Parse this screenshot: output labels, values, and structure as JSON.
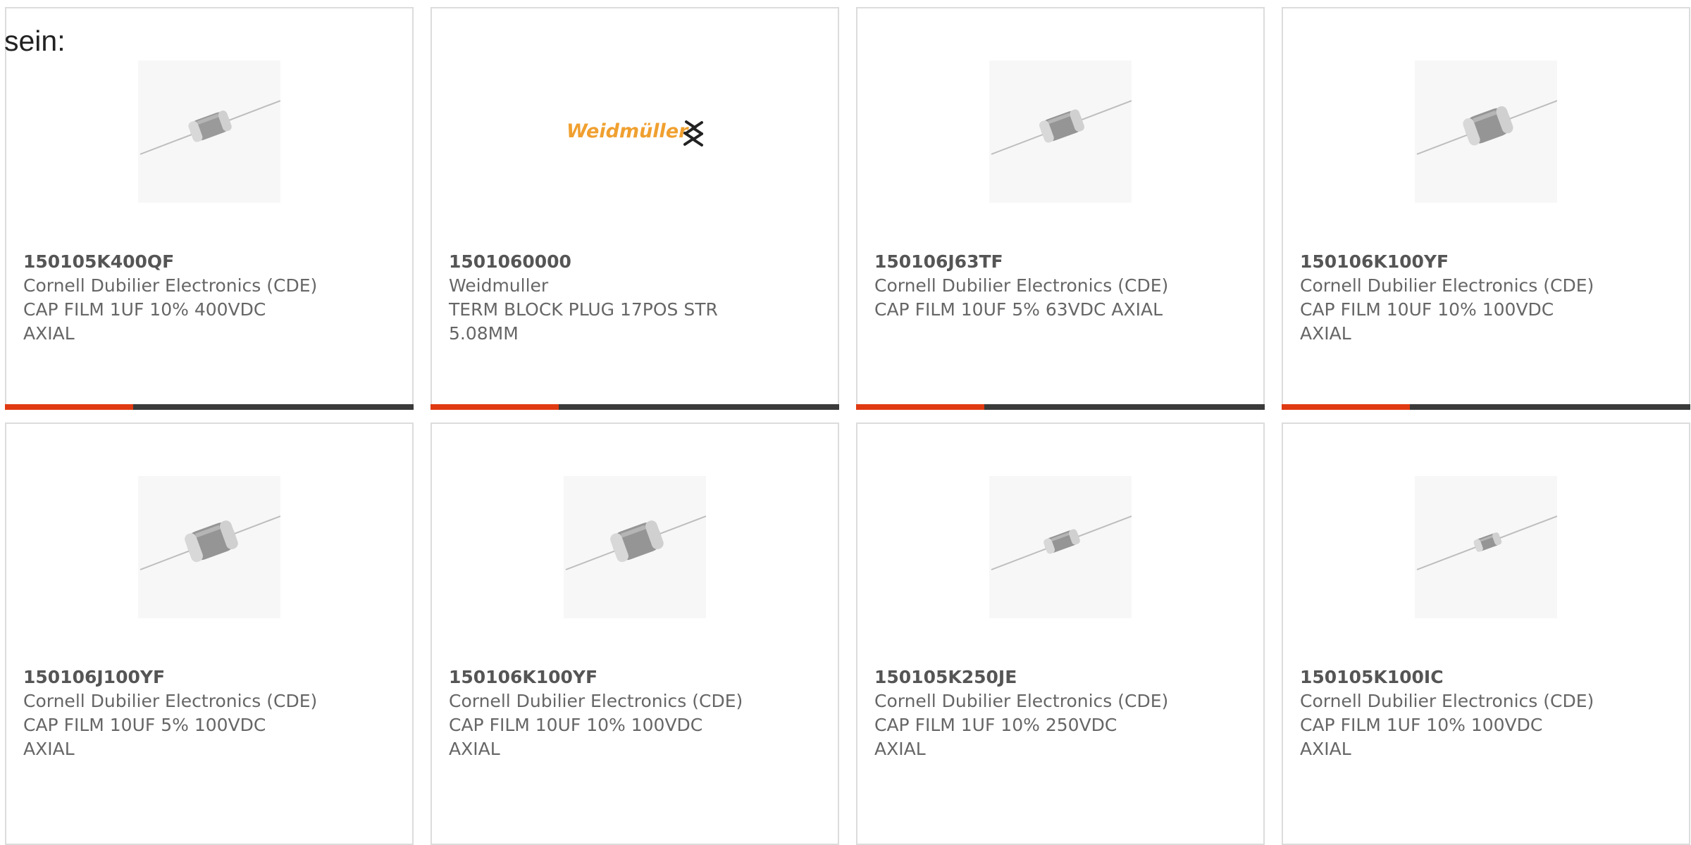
{
  "intro_text": "sein:",
  "colors": {
    "accent": "#e03a12",
    "bar": "#3a3a3a",
    "brand_orange": "#f0a030"
  },
  "products": [
    {
      "part_number": "150105K400QF",
      "manufacturer": "Cornell Dubilier Electronics (CDE)",
      "description_line1": "CAP FILM 1UF 10% 400VDC",
      "description_line2": "AXIAL",
      "image": "axial-capacitor-icon"
    },
    {
      "part_number": "1501060000",
      "manufacturer": "Weidmuller",
      "description_line1": "TERM BLOCK PLUG 17POS STR",
      "description_line2": "5.08MM",
      "image": "weidmuller-logo",
      "logo_text": "Weidmüller"
    },
    {
      "part_number": "150106J63TF",
      "manufacturer": "Cornell Dubilier Electronics (CDE)",
      "description_line1": "CAP FILM 10UF 5% 63VDC AXIAL",
      "description_line2": "",
      "image": "axial-capacitor-icon"
    },
    {
      "part_number": "150106K100YF",
      "manufacturer": "Cornell Dubilier Electronics (CDE)",
      "description_line1": "CAP FILM 10UF 10% 100VDC",
      "description_line2": "AXIAL",
      "image": "axial-capacitor-icon"
    },
    {
      "part_number": "150106J100YF",
      "manufacturer": "Cornell Dubilier Electronics (CDE)",
      "description_line1": "CAP FILM 10UF 5% 100VDC",
      "description_line2": "AXIAL",
      "image": "axial-capacitor-icon"
    },
    {
      "part_number": "150106K100YF",
      "manufacturer": "Cornell Dubilier Electronics (CDE)",
      "description_line1": "CAP FILM 10UF 10% 100VDC",
      "description_line2": "AXIAL",
      "image": "axial-capacitor-icon"
    },
    {
      "part_number": "150105K250JE",
      "manufacturer": "Cornell Dubilier Electronics (CDE)",
      "description_line1": "CAP FILM 1UF 10% 250VDC",
      "description_line2": "AXIAL",
      "image": "axial-capacitor-icon"
    },
    {
      "part_number": "150105K100IC",
      "manufacturer": "Cornell Dubilier Electronics (CDE)",
      "description_line1": "CAP FILM 1UF 10% 100VDC",
      "description_line2": "AXIAL",
      "image": "axial-capacitor-icon"
    }
  ]
}
